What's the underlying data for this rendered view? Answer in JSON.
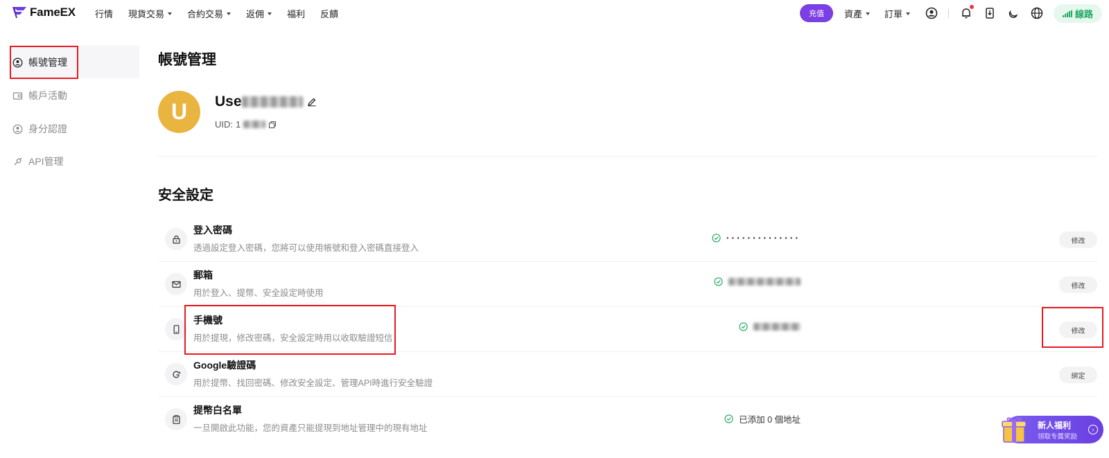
{
  "brand": {
    "name": "FameEX",
    "accent": "#7b3fe4"
  },
  "nav": {
    "items": [
      {
        "label": "行情",
        "dropdown": false
      },
      {
        "label": "現貨交易",
        "dropdown": true
      },
      {
        "label": "合約交易",
        "dropdown": true
      },
      {
        "label": "返佣",
        "dropdown": true
      },
      {
        "label": "福利",
        "dropdown": false
      },
      {
        "label": "反饋",
        "dropdown": false
      }
    ],
    "deposit_label": "充值",
    "assets_label": "資產",
    "orders_label": "訂單",
    "line_label": "線路",
    "line_color": "#1fa860"
  },
  "sidebar": {
    "items": [
      {
        "label": "帳號管理",
        "icon": "user-circle-icon",
        "active": true
      },
      {
        "label": "帳戶活動",
        "icon": "wallet-icon",
        "active": false
      },
      {
        "label": "身分認證",
        "icon": "id-user-icon",
        "active": false
      },
      {
        "label": "API管理",
        "icon": "api-link-icon",
        "active": false
      }
    ]
  },
  "profile": {
    "page_title": "帳號管理",
    "avatar_letter": "U",
    "avatar_color": "#e9b440",
    "username_prefix": "Use",
    "uid_label": "UID:",
    "uid_prefix": "1"
  },
  "security": {
    "title": "安全設定",
    "rows": [
      {
        "title": "登入密碼",
        "desc": "透過設定登入密碼，您將可以使用帳號和登入密碼直接登入",
        "status": "··············",
        "status_type": "dots",
        "button": "修改",
        "icon": "lock-icon"
      },
      {
        "title": "郵箱",
        "desc": "用於登入、提幣、安全設定時使用",
        "status": "",
        "status_type": "masked",
        "button": "修改",
        "icon": "mail-icon"
      },
      {
        "title": "手機號",
        "desc": "用於提現，修改密碼，安全設定時用以收取驗證短信",
        "status": "",
        "status_type": "masked",
        "button": "修改",
        "icon": "phone-icon"
      },
      {
        "title": "Google驗證碼",
        "desc": "用於提幣、找回密碼、修改安全設定、管理API時進行安全驗證",
        "status": "",
        "status_type": "none",
        "button": "綁定",
        "icon": "google-icon"
      },
      {
        "title": "提幣白名單",
        "desc": "一旦開啟此功能，您的資產只能提現到地址管理中的現有地址",
        "status": "已添加 0 個地址",
        "status_type": "text",
        "button": "",
        "icon": "clipboard-icon"
      }
    ]
  },
  "promo": {
    "title": "新人福利",
    "subtitle": "领取专属奖励"
  }
}
